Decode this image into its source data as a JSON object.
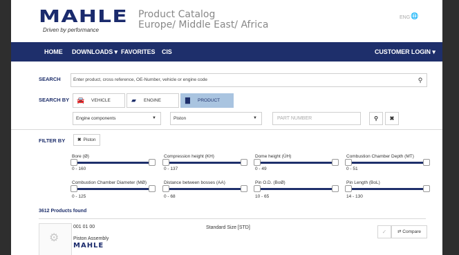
{
  "header": {
    "logo": "MAHLE",
    "tagline": "Driven by performance",
    "catalog_title": "Product Catalog",
    "catalog_region": "Europe/ Middle East/ Africa",
    "lang": "ENG"
  },
  "nav": {
    "home": "HOME",
    "downloads": "DOWNLOADS",
    "favorites": "FAVORITES",
    "cis": "CIS",
    "login": "CUSTOMER LOGIN"
  },
  "search": {
    "label": "SEARCH",
    "placeholder": "Enter product, cross reference, OE-Number, vehicle or engine code",
    "value": ""
  },
  "search_by": {
    "label": "SEARCH BY",
    "tabs": [
      {
        "label": "VEHICLE",
        "icon": "car-icon",
        "active": false
      },
      {
        "label": "ENGINE",
        "icon": "engine-icon",
        "active": false
      },
      {
        "label": "PRODUCT",
        "icon": "product-icon",
        "active": true
      }
    ],
    "category": "Engine components",
    "product": "Piston",
    "part_placeholder": "PART NUMBER"
  },
  "filter": {
    "label": "FILTER BY",
    "chip": "Piston",
    "sliders": [
      {
        "label": "Bore (Ø)",
        "range": "0 - 160"
      },
      {
        "label": "Compression height (KH)",
        "range": "0 - 137"
      },
      {
        "label": "Dome height (ÜH)",
        "range": "0 - 49"
      },
      {
        "label": "Combustion Chamber Depth (MT)",
        "range": "0 - 51"
      },
      {
        "label": "Combustion Chamber Diameter (MØ)",
        "range": "0 - 125"
      },
      {
        "label": "Distance between bosses (AA)",
        "range": "0 - 68"
      },
      {
        "label": "Pin O.D. (BoØ)",
        "range": "10 - 65"
      },
      {
        "label": "Pin Length (BoL)",
        "range": "14 - 130"
      }
    ]
  },
  "results": {
    "count": "3612 Products found",
    "items": [
      {
        "number": "001 01 00",
        "name": "Piston Assembly",
        "brand": "MAHLE",
        "size": "Standard Size [STD]",
        "compare": "Compare"
      }
    ]
  },
  "colors": {
    "brand": "#1e2f6b",
    "active_tab": "#a9c4e0"
  }
}
